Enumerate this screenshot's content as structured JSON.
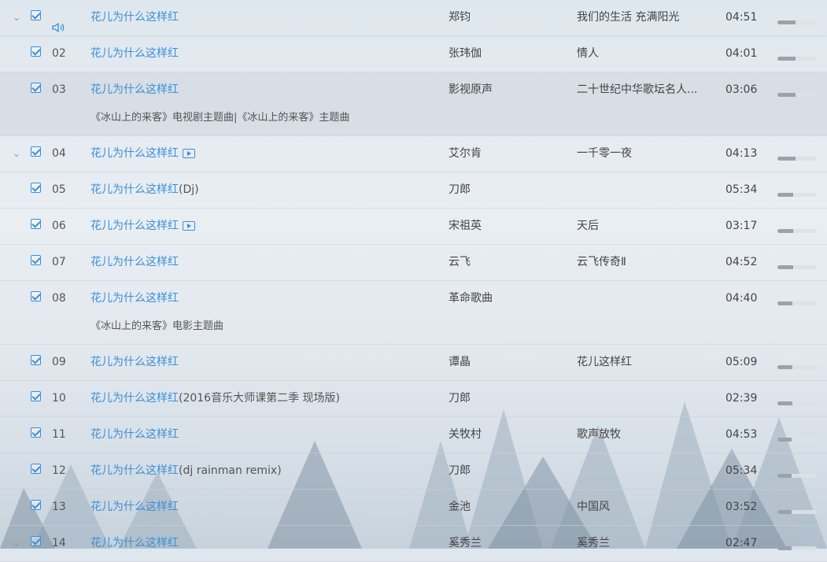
{
  "colors": {
    "accent": "#3a8fd8",
    "text": "#444444"
  },
  "songs": [
    {
      "num": "",
      "playing": true,
      "expanded": true,
      "title": "花儿为什么这样红",
      "suffix": "",
      "mv": false,
      "artist": "郑钧",
      "album": "我们的生活 充满阳光",
      "duration": "04:51",
      "popularity": 0.45,
      "desc": ""
    },
    {
      "num": "02",
      "playing": false,
      "expanded": false,
      "title": "花儿为什么这样红",
      "suffix": "",
      "mv": false,
      "artist": "张玮伽",
      "album": "情人",
      "duration": "04:01",
      "popularity": 0.45,
      "desc": ""
    },
    {
      "num": "03",
      "playing": false,
      "expanded": false,
      "title": "花儿为什么这样红",
      "suffix": "",
      "mv": false,
      "artist": "影视原声",
      "album": "二十世纪中华歌坛名人...",
      "duration": "03:06",
      "popularity": 0.45,
      "desc": "《冰山上的来客》电视剧主题曲|《冰山上的来客》主题曲",
      "highlight": true
    },
    {
      "num": "04",
      "playing": false,
      "expanded": true,
      "title": "花儿为什么这样红",
      "suffix": "",
      "mv": true,
      "artist": "艾尔肯",
      "album": "一千零一夜",
      "duration": "04:13",
      "popularity": 0.45,
      "desc": ""
    },
    {
      "num": "05",
      "playing": false,
      "expanded": false,
      "title": "花儿为什么这样红",
      "suffix": "(Dj)",
      "mv": false,
      "artist": "刀郎",
      "album": "",
      "duration": "05:34",
      "popularity": 0.4,
      "desc": ""
    },
    {
      "num": "06",
      "playing": false,
      "expanded": false,
      "title": "花儿为什么这样红",
      "suffix": "",
      "mv": true,
      "artist": "宋祖英",
      "album": "天后",
      "duration": "03:17",
      "popularity": 0.4,
      "desc": ""
    },
    {
      "num": "07",
      "playing": false,
      "expanded": false,
      "title": "花儿为什么这样红",
      "suffix": "",
      "mv": false,
      "artist": "云飞",
      "album": "云飞传奇Ⅱ",
      "duration": "04:52",
      "popularity": 0.4,
      "desc": ""
    },
    {
      "num": "08",
      "playing": false,
      "expanded": false,
      "title": "花儿为什么这样红",
      "suffix": "",
      "mv": false,
      "artist": "革命歌曲",
      "album": "",
      "duration": "04:40",
      "popularity": 0.38,
      "desc": "《冰山上的来客》电影主题曲"
    },
    {
      "num": "09",
      "playing": false,
      "expanded": false,
      "title": "花儿为什么这样红",
      "suffix": "",
      "mv": false,
      "artist": "谭晶",
      "album": "花儿这样红",
      "duration": "05:09",
      "popularity": 0.38,
      "desc": ""
    },
    {
      "num": "10",
      "playing": false,
      "expanded": false,
      "title": "花儿为什么这样红",
      "suffix": "(2016音乐大师课第二季 现场版)",
      "mv": false,
      "artist": "刀郎",
      "album": "",
      "duration": "02:39",
      "popularity": 0.38,
      "desc": ""
    },
    {
      "num": "11",
      "playing": false,
      "expanded": false,
      "title": "花儿为什么这样红",
      "suffix": "",
      "mv": false,
      "artist": "关牧村",
      "album": "歌声放牧",
      "duration": "04:53",
      "popularity": 0.35,
      "desc": ""
    },
    {
      "num": "12",
      "playing": false,
      "expanded": false,
      "title": "花儿为什么这样红",
      "suffix": "(dj rainman remix)",
      "mv": false,
      "artist": "刀郎",
      "album": "",
      "duration": "05:34",
      "popularity": 0.35,
      "desc": ""
    },
    {
      "num": "13",
      "playing": false,
      "expanded": false,
      "title": "花儿为什么这样红",
      "suffix": "",
      "mv": false,
      "artist": "金池",
      "album": "中国风",
      "duration": "03:52",
      "popularity": 0.35,
      "desc": ""
    },
    {
      "num": "14",
      "playing": false,
      "expanded": true,
      "title": "花儿为什么这样红",
      "suffix": "",
      "mv": false,
      "artist": "奚秀兰",
      "album": "奚秀兰",
      "duration": "02:47",
      "popularity": 0.35,
      "desc": ""
    }
  ]
}
